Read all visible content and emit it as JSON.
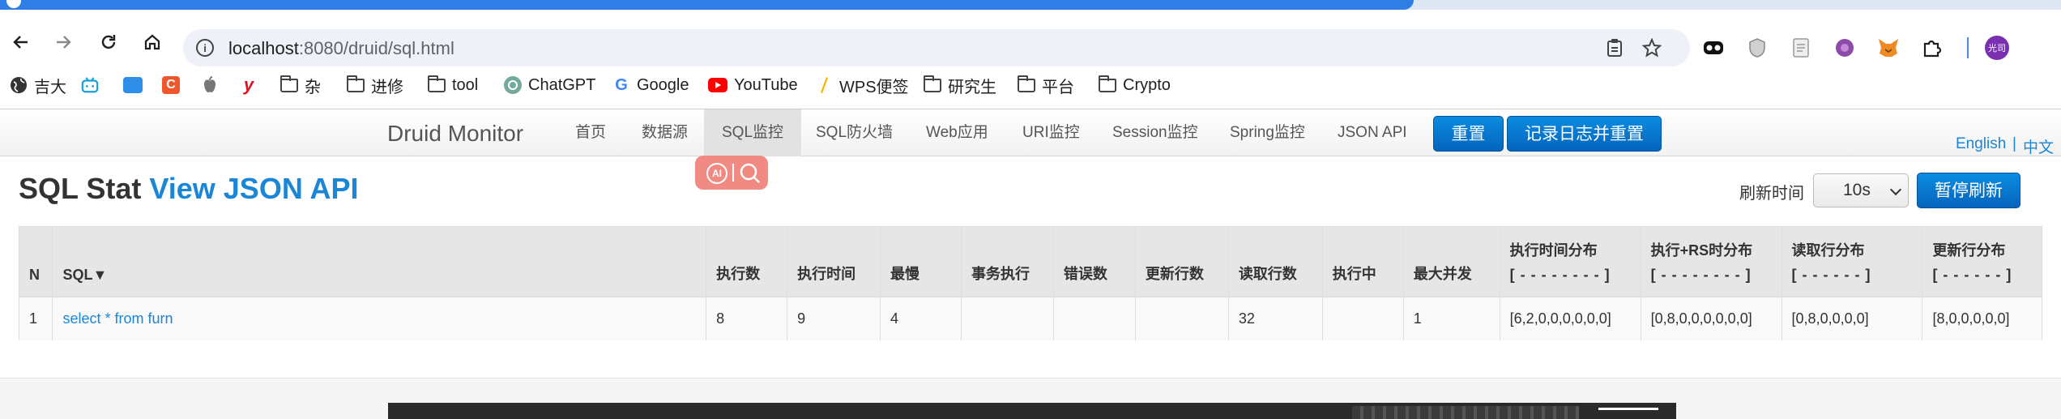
{
  "browser": {
    "url_host": "localhost",
    "url_path": ":8080/druid/sql.html",
    "profile_label": "光司"
  },
  "bookmarks": [
    {
      "label": "吉大",
      "icon": "globe-icon"
    },
    {
      "label": "",
      "icon": "bilibili-icon"
    },
    {
      "label": "",
      "icon": "cloud-drive-icon"
    },
    {
      "label": "",
      "icon": "c-app-icon"
    },
    {
      "label": "",
      "icon": "apple-icon"
    },
    {
      "label": "",
      "icon": "y-app-icon"
    },
    {
      "label": "杂",
      "icon": "folder-icon"
    },
    {
      "label": "进修",
      "icon": "folder-icon"
    },
    {
      "label": "tool",
      "icon": "folder-icon"
    },
    {
      "label": "ChatGPT",
      "icon": "chatgpt-icon"
    },
    {
      "label": "Google",
      "icon": "google-icon"
    },
    {
      "label": "YouTube",
      "icon": "youtube-icon"
    },
    {
      "label": "WPS便签",
      "icon": "wps-note-icon"
    },
    {
      "label": "研究生",
      "icon": "folder-icon"
    },
    {
      "label": "平台",
      "icon": "folder-icon"
    },
    {
      "label": "Crypto",
      "icon": "folder-icon"
    }
  ],
  "nav": {
    "brand": "Druid Monitor",
    "items": [
      "首页",
      "数据源",
      "SQL监控",
      "SQL防火墙",
      "Web应用",
      "URI监控",
      "Session监控",
      "Spring监控",
      "JSON API"
    ],
    "active_index": 2,
    "reset_button": "重置",
    "reset_log_button": "记录日志并重置",
    "lang_en": "English",
    "lang_sep": "|",
    "lang_zh": "中文"
  },
  "page": {
    "title_main": "SQL Stat",
    "title_link": "View JSON API",
    "refresh_label": "刷新时间",
    "refresh_value": "10s",
    "pause_button": "暂停刷新"
  },
  "table": {
    "headers": [
      {
        "label": "N"
      },
      {
        "label": "SQL▼"
      },
      {
        "label": "执行数"
      },
      {
        "label": "执行时间"
      },
      {
        "label": "最慢"
      },
      {
        "label": "事务执行"
      },
      {
        "label": "错误数"
      },
      {
        "label": "更新行数"
      },
      {
        "label": "读取行数"
      },
      {
        "label": "执行中"
      },
      {
        "label": "最大并发"
      },
      {
        "label": "执行时间分布",
        "sub": "[ - - - - - - - - ]"
      },
      {
        "label": "执行+RS时分布",
        "sub": "[ - - - - - - - - ]"
      },
      {
        "label": "读取行分布",
        "sub": "[ - - - - - - ]"
      },
      {
        "label": "更新行分布",
        "sub": "[ - - - - - - ]"
      }
    ],
    "rows": [
      [
        "1",
        "select * from furn",
        "8",
        "9",
        "4",
        "",
        "",
        "",
        "32",
        "",
        "1",
        "[6,2,0,0,0,0,0,0]",
        "[0,8,0,0,0,0,0,0]",
        "[0,8,0,0,0,0]",
        "[8,0,0,0,0,0]"
      ]
    ]
  },
  "colors": {
    "accent": "#1b85d6",
    "primary_button": "#0672cd",
    "tab_blue": "#2f7ee6",
    "ai_float": "#f28a84"
  }
}
